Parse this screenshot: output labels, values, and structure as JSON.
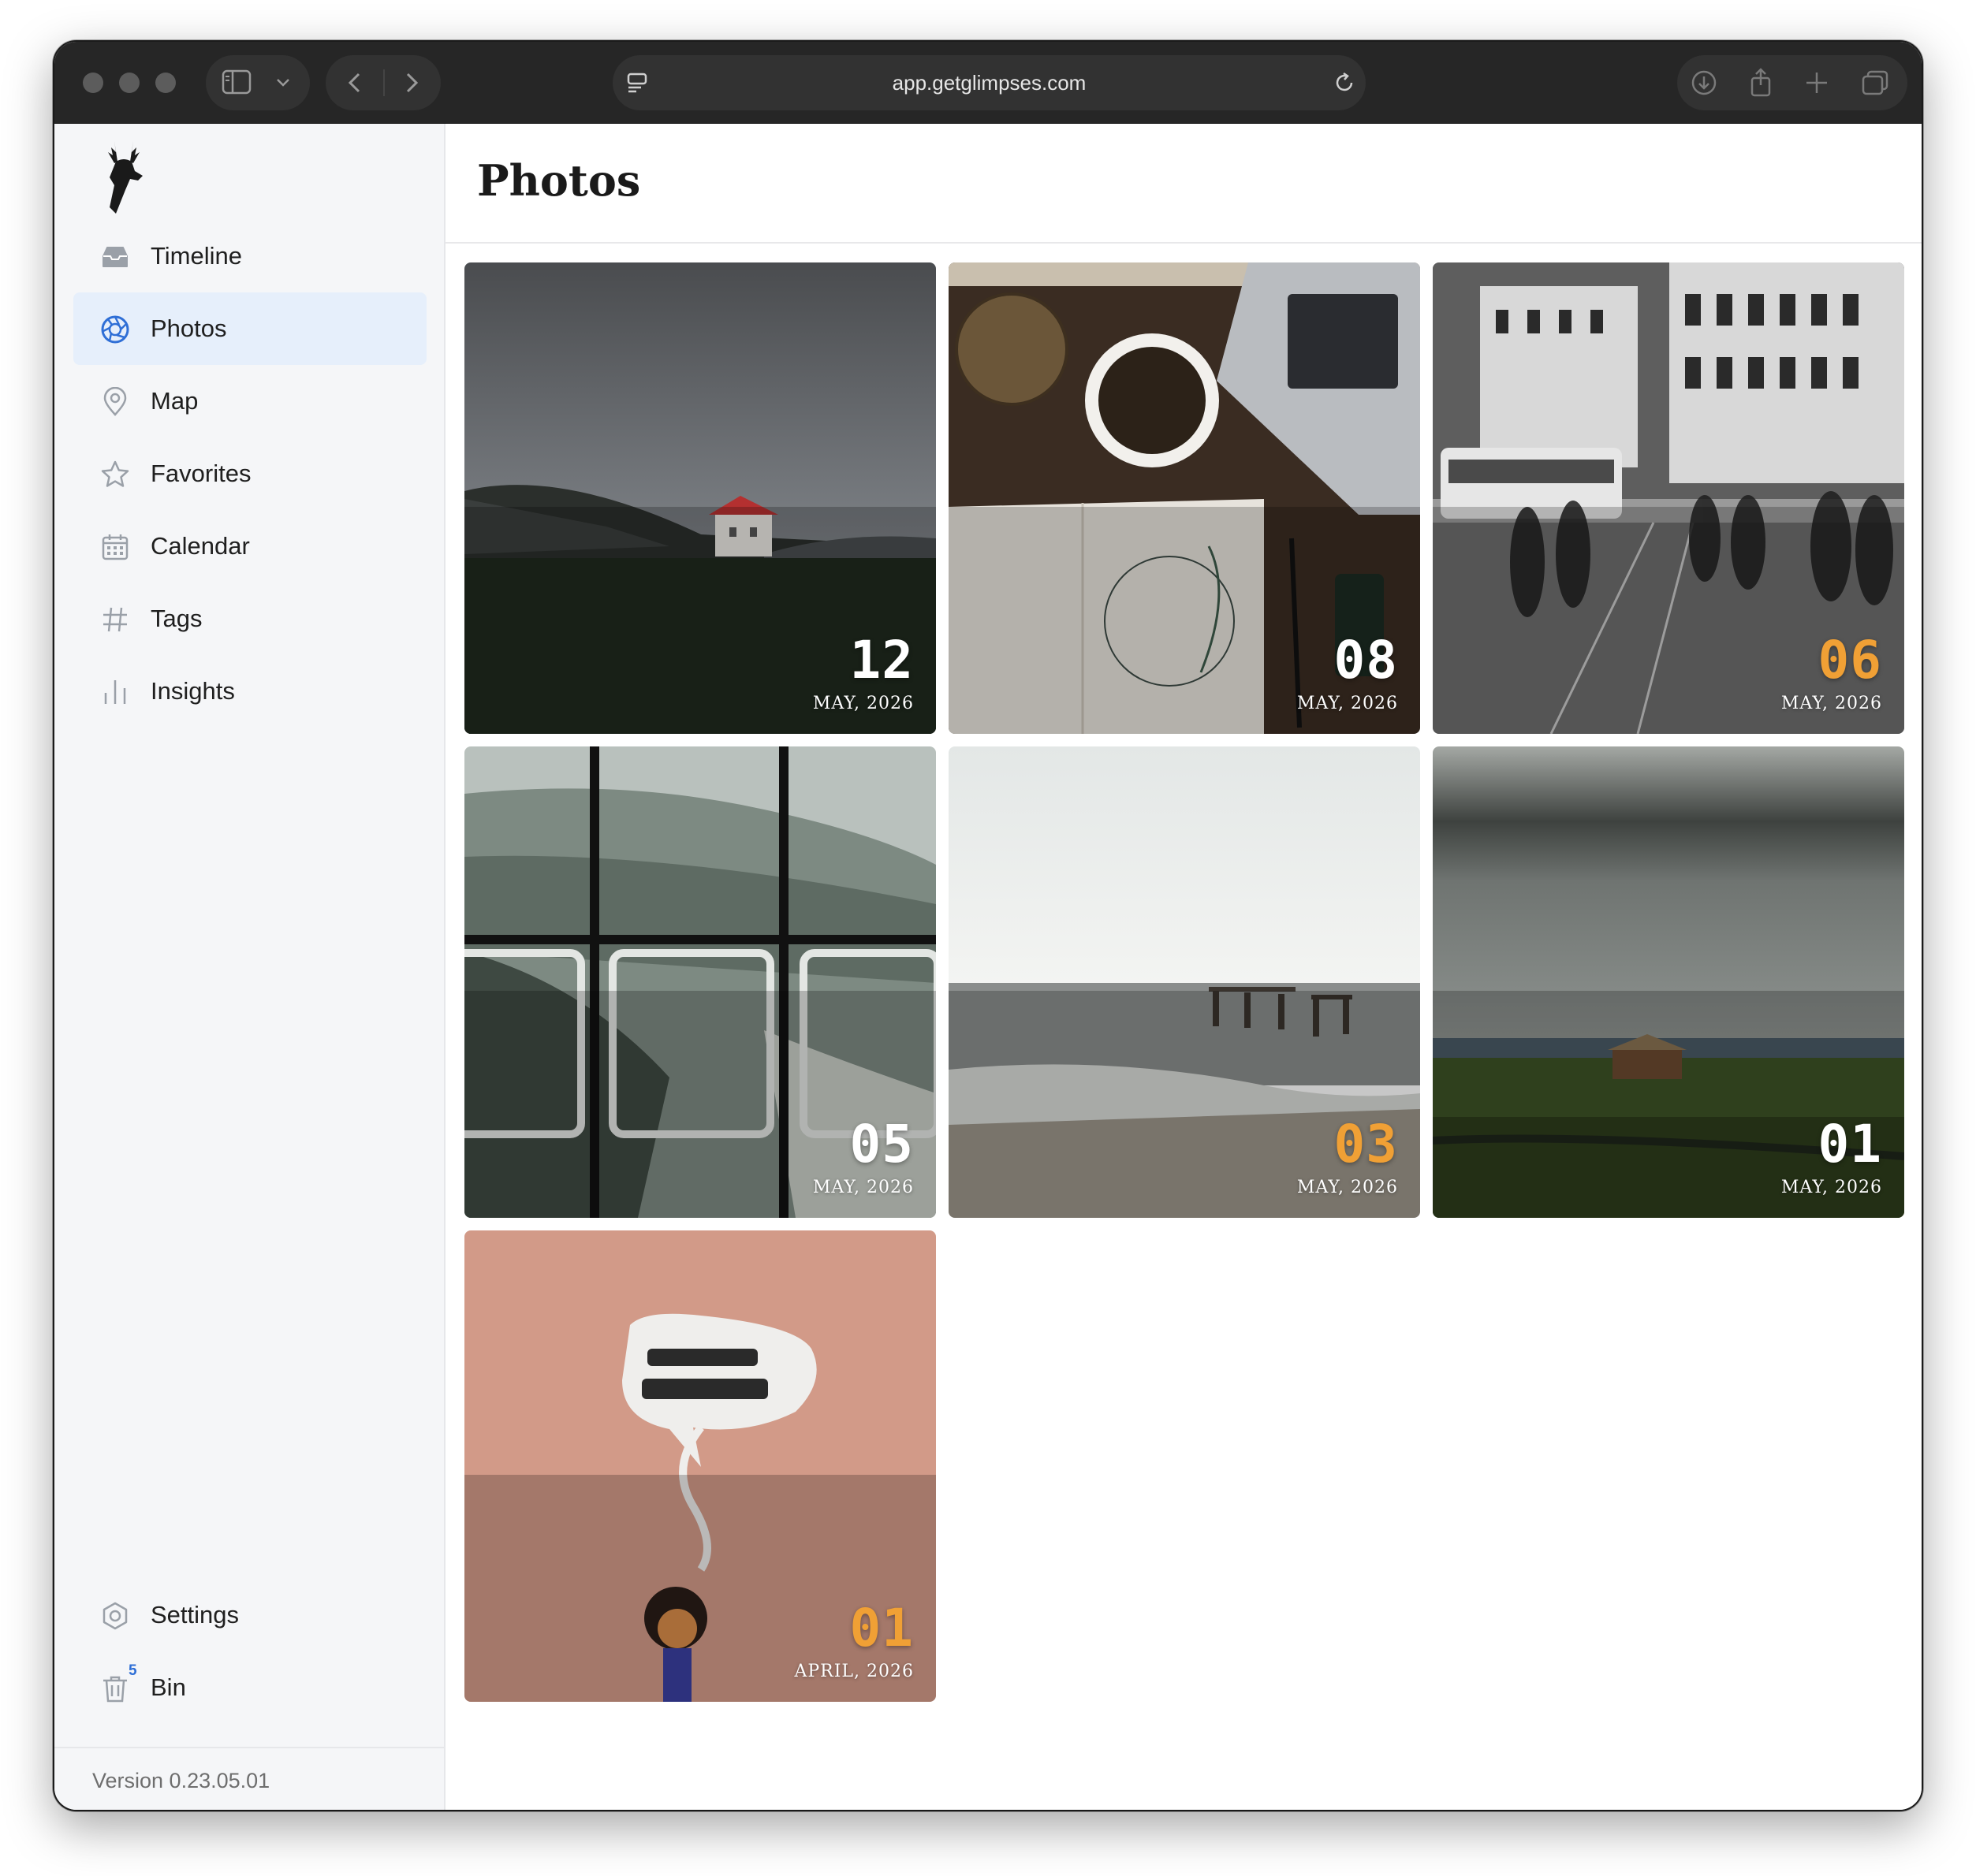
{
  "browser": {
    "url": "app.getglimpses.com"
  },
  "sidebar": {
    "items": [
      {
        "label": "Timeline",
        "icon": "inbox-icon",
        "active": false
      },
      {
        "label": "Photos",
        "icon": "aperture-icon",
        "active": true
      },
      {
        "label": "Map",
        "icon": "map-pin-icon",
        "active": false
      },
      {
        "label": "Favorites",
        "icon": "star-icon",
        "active": false
      },
      {
        "label": "Calendar",
        "icon": "calendar-icon",
        "active": false
      },
      {
        "label": "Tags",
        "icon": "hash-icon",
        "active": false
      },
      {
        "label": "Insights",
        "icon": "bar-chart-icon",
        "active": false
      }
    ],
    "bottom_items": [
      {
        "label": "Settings",
        "icon": "settings-icon"
      },
      {
        "label": "Bin",
        "icon": "trash-icon",
        "badge": "5"
      }
    ],
    "version": "Version 0.23.05.01"
  },
  "main": {
    "title": "Photos",
    "photos": [
      {
        "day": "12",
        "month": "MAY, 2026",
        "highlight": false,
        "scene": "house-on-hill"
      },
      {
        "day": "08",
        "month": "MAY, 2026",
        "highlight": false,
        "scene": "coffee-desk"
      },
      {
        "day": "06",
        "month": "MAY, 2026",
        "highlight": true,
        "scene": "city-street"
      },
      {
        "day": "05",
        "month": "MAY, 2026",
        "highlight": false,
        "scene": "window-coast"
      },
      {
        "day": "03",
        "month": "MAY, 2026",
        "highlight": true,
        "scene": "beach-pier"
      },
      {
        "day": "01",
        "month": "MAY, 2026",
        "highlight": false,
        "scene": "storm-field"
      },
      {
        "day": "01",
        "month": "APRIL, 2026",
        "highlight": true,
        "scene": "speech-bubble"
      }
    ]
  },
  "colors": {
    "accent": "#2f6fd6",
    "active_bg": "#e6effb",
    "highlight_day": "#f0a035"
  }
}
